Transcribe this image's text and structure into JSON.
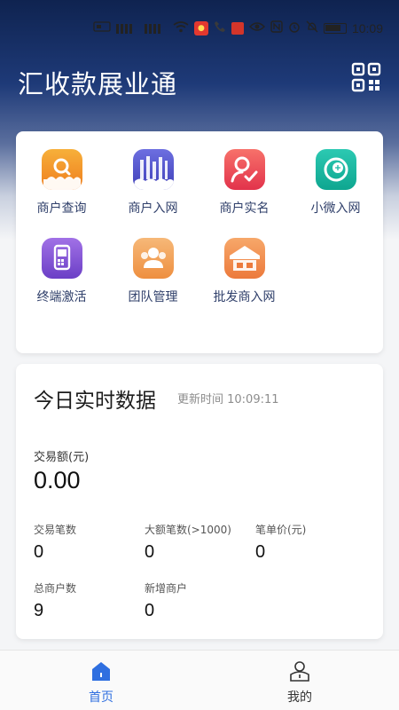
{
  "status_bar": {
    "time": "10:09",
    "icons": [
      "sim-icon",
      "signal-icon",
      "signal-icon",
      "wifi-icon",
      "app-badge-icon",
      "call-icon",
      "app-badge-icon",
      "eye-icon",
      "nfc-icon",
      "alarm-icon",
      "mute-icon",
      "battery-icon"
    ]
  },
  "header": {
    "title": "汇收款展业通",
    "qr_icon": "qr-code-icon"
  },
  "menu": {
    "items": [
      {
        "label": "商户查询",
        "icon": "merchant-search-icon",
        "color": "#f29b26"
      },
      {
        "label": "商户入网",
        "icon": "merchant-onboard-icon",
        "color": "#5b63d8"
      },
      {
        "label": "商户实名",
        "icon": "merchant-verify-icon",
        "color": "#f0515b"
      },
      {
        "label": "小微入网",
        "icon": "micro-onboard-icon",
        "color": "#17b7a3"
      },
      {
        "label": "终端激活",
        "icon": "terminal-activate-icon",
        "color": "#8a55d6"
      },
      {
        "label": "团队管理",
        "icon": "team-manage-icon",
        "color": "#f2a25a"
      },
      {
        "label": "批发商入网",
        "icon": "wholesaler-onboard-icon",
        "color": "#f28a50"
      }
    ]
  },
  "realtime": {
    "title": "今日实时数据",
    "updated": "更新时间 10:09:11",
    "amount_label": "交易额(元)",
    "amount_value": "0.00",
    "stats": [
      {
        "label": "交易笔数",
        "value": "0"
      },
      {
        "label": "大额笔数(>1000)",
        "value": "0"
      },
      {
        "label": "笔单价(元)",
        "value": "0"
      },
      {
        "label": "总商户数",
        "value": "9"
      },
      {
        "label": "新增商户",
        "value": "0"
      }
    ]
  },
  "bottom_nav": {
    "home": {
      "label": "首页",
      "color": "#2f6fe0"
    },
    "mine": {
      "label": "我的",
      "color": "#333333"
    }
  }
}
